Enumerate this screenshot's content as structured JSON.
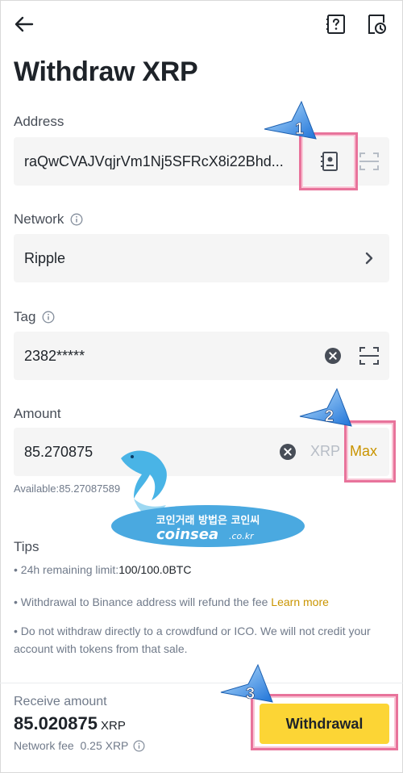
{
  "header": {
    "title": "Withdraw XRP"
  },
  "address": {
    "label": "Address",
    "value": "raQwCVAJVqjrVm1Nj5SFRcX8i22Bhd..."
  },
  "network": {
    "label": "Network",
    "value": "Ripple"
  },
  "tag": {
    "label": "Tag",
    "value": "2382*****"
  },
  "amount": {
    "label": "Amount",
    "value": "85.270875",
    "unit": "XRP",
    "max_label": "Max",
    "available": "Available:85.27087589"
  },
  "tips": {
    "title": "Tips",
    "limit_prefix": "• 24h remaining limit:",
    "limit_value": "100/100.0BTC",
    "refund_text": "• Withdrawal to Binance address will refund the fee",
    "learn_more": "Learn more",
    "crowdfund": "• Do not withdraw directly to a crowdfund or ICO. We will not credit your account with tokens from that sale."
  },
  "receive": {
    "label": "Receive amount",
    "amount": "85.020875",
    "unit": "XRP",
    "fee": "Network fee  0.25 XRP"
  },
  "actions": {
    "withdraw_label": "Withdrawal"
  },
  "annotations": {
    "step1": "1",
    "step2": "2",
    "step3": "3"
  },
  "watermark": {
    "korean": "코인거래 방법은 코인씨",
    "brand": "coinsea",
    "domain": ".co.kr"
  },
  "colors": {
    "accent": "#fcd535",
    "link": "#c99400",
    "highlight": "#e8739b",
    "field_bg": "#f5f5f5"
  }
}
